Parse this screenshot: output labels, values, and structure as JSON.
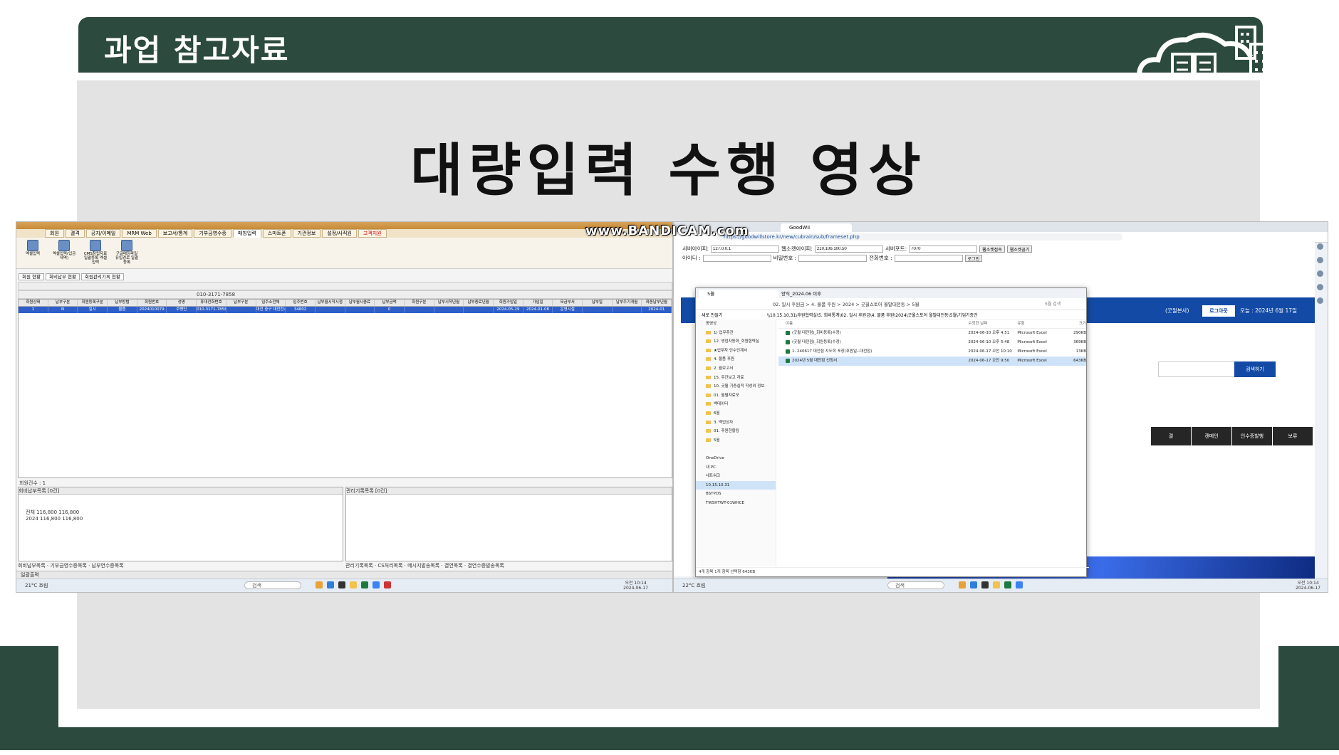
{
  "slide": {
    "header_title": "과업 참고자료",
    "main_title": "대량입력 수행 영상",
    "colors": {
      "header": "#2c4a3d",
      "panel": "#e3e3e3",
      "accent_blue": "#124aa6"
    },
    "logo_icon": "cloud-buildings-icon",
    "watermark": "www.BANDICAM.com"
  },
  "left_app": {
    "menu": [
      "회원",
      "결격",
      "공지/이메일",
      "MRM Web",
      "보고서/통계",
      "기부금영수증",
      "매칭입력",
      "스마트폰",
      "기관정보",
      "설정/사직원",
      "고객지원"
    ],
    "active_menu": "매칭입력",
    "ribbon": [
      "엑셀입력",
      "엑셀입력(입금내역)",
      "CMS창립자료 일괄등록 엑셀입력",
      "구글매칭파일 유입경로 일괄등록"
    ],
    "tabs": [
      "회원 현황",
      "회비납부 현황",
      "회원관리기록 현황"
    ],
    "search_phone": "010-3171-7858",
    "grid_headers": [
      "회원상태",
      "납부구분",
      "회원등록구분",
      "납부방법",
      "회원번호",
      "성명",
      "휴대전화번호",
      "납부구분",
      "입주소전체",
      "입주번호",
      "납부월시작시점",
      "납부월시종료",
      "납부금액",
      "회원구분",
      "납부시작년월",
      "납부종료년월",
      "회원가입일",
      "가입일",
      "모금부서",
      "납부일",
      "납부주기개월",
      "최종납부년월"
    ],
    "grid_row": [
      "1",
      "N",
      "일시",
      "물품",
      "2024010079",
      "주병인",
      "010-3171-7858",
      "",
      "대전 중구 대전천서로 709 108-1402",
      "34802",
      "",
      "",
      "0",
      "",
      "",
      "",
      "2024-05-29",
      "2024-01-08",
      "운영시설",
      "",
      "",
      "2024-01"
    ],
    "record_count": "회원건수 : 1",
    "sub_left_title": "회비납부목록 [0건]",
    "sub_right_title": "관리기록목록 [0건]",
    "sub_left_rows": [
      "전체 116,800 116,800",
      "2024 116,800 116,800"
    ],
    "bottom_tabs_left": [
      "회비납부목록",
      "기부금영수증목록",
      "납부연수증목록"
    ],
    "bottom_tabs_right": [
      "관리기록목록",
      "CS처리목록",
      "메시지발송목록",
      "결연목록",
      "결연수증발송목록"
    ],
    "status": "일괄출력",
    "taskbar_weather": "21°C 흐림",
    "taskbar_search": "검색",
    "clock_time": "오전 10:14",
    "clock_date": "2024-06-17"
  },
  "right_browser": {
    "tab1": "GoodWii",
    "url": "https://goodwillstore.kr/new/cubrain/sub/frameset.php",
    "form": {
      "server_ip_label": "서버아이피:",
      "server_ip": "127.0.0.1",
      "web_ip_label": "웹소켓아이피:",
      "web_ip": "210.106.100.50",
      "server_port_label": "서버포트:",
      "server_port": "7070",
      "connect_btn": "웹소켓접속",
      "disconnect_btn": "웹소켓끊기",
      "id_label": "아이디 :",
      "pw_label": "비밀번호 :",
      "phone_label": "전화번호 :",
      "login_btn": "로그인"
    },
    "site_loc": "(굿윌본사)",
    "logout_btn": "로그아웃",
    "today": "오늘 : 2024년 6월 17일",
    "search_btn": "검색하기",
    "actions": [
      "결",
      "캔메인",
      "인수증발행",
      "보류"
    ]
  },
  "explorer": {
    "tabs": [
      "5월",
      "양식_2024.06 이후"
    ],
    "path": "02. 일시 후원금 > 4. 물품 후원 > 2024 > 굿윌스토어 월말대전동 > 5월",
    "search": "5월 검색",
    "command": "새로 만들기",
    "address_line": "\\\\10.15.10.31\\후원협력실\\5. 회비통계\\02. 일시 후원금\\4. 물품 후원\\2024\\굿윌스토어 월말대전동\\5월\\기업기증건",
    "sidebar": [
      {
        "label": "동영상",
        "folder": false,
        "selected": false
      },
      {
        "label": "1) 업무추진",
        "folder": true,
        "selected": false
      },
      {
        "label": "12. 영업자동화_회원협력실",
        "folder": true,
        "selected": false
      },
      {
        "label": "★업무자 인수인계서",
        "folder": true,
        "selected": false
      },
      {
        "label": "4. 물품 후원",
        "folder": true,
        "selected": false
      },
      {
        "label": "2. 월보고서",
        "folder": true,
        "selected": false
      },
      {
        "label": "15. 주간보고 자료",
        "folder": true,
        "selected": false
      },
      {
        "label": "10. 굿윌 기증실적 작성외 정보",
        "folder": true,
        "selected": false
      },
      {
        "label": "01. 월별자료모",
        "folder": true,
        "selected": false
      },
      {
        "label": "백데이터",
        "folder": true,
        "selected": false
      },
      {
        "label": "6월",
        "folder": true,
        "selected": false
      },
      {
        "label": "3. 백업상자",
        "folder": true,
        "selected": false
      },
      {
        "label": "01. 후원현황팅",
        "folder": true,
        "selected": false
      },
      {
        "label": "5월",
        "folder": true,
        "selected": false
      },
      {
        "label": "",
        "folder": false,
        "selected": false
      },
      {
        "label": "OneDrive",
        "folder": false,
        "selected": false
      },
      {
        "label": "내 PC",
        "folder": false,
        "selected": false
      },
      {
        "label": "네트워크",
        "folder": false,
        "selected": false
      },
      {
        "label": "10.15.10.31",
        "folder": false,
        "selected": true
      },
      {
        "label": "BSTPOS",
        "folder": false,
        "selected": false
      },
      {
        "label": "TWSHTWT-01WHCE",
        "folder": false,
        "selected": false
      }
    ],
    "headers": [
      "이름",
      "수정한 날짜",
      "유형",
      "크기"
    ],
    "files": [
      {
        "name": "(굿윌 대전점)_회비등록(수정)",
        "date": "2024-06-10 오후 4:51",
        "type": "Microsoft Excel",
        "size": "290KB",
        "selected": false
      },
      {
        "name": "(굿윌 대전점)_회원등록(수정)",
        "date": "2024-06-10 오후 5:48",
        "type": "Microsoft Excel",
        "size": "369KB",
        "selected": false
      },
      {
        "name": "1. 240617 대전점 지도학 포장(후원일--대전점)",
        "date": "2024-06-17 오전 10:10",
        "type": "Microsoft Excel",
        "size": "13KB",
        "selected": false
      },
      {
        "name": "2024년 5월 대전점 신청서",
        "date": "2024-06-17 오전 9:50",
        "type": "Microsoft Excel",
        "size": "643KB",
        "selected": true
      }
    ],
    "status": "4개 항목   1개 항목 선택함 643KB",
    "taskbar_weather": "22°C 흐림",
    "clock_time": "오전 10:14",
    "clock_date": "2024-06-17"
  }
}
